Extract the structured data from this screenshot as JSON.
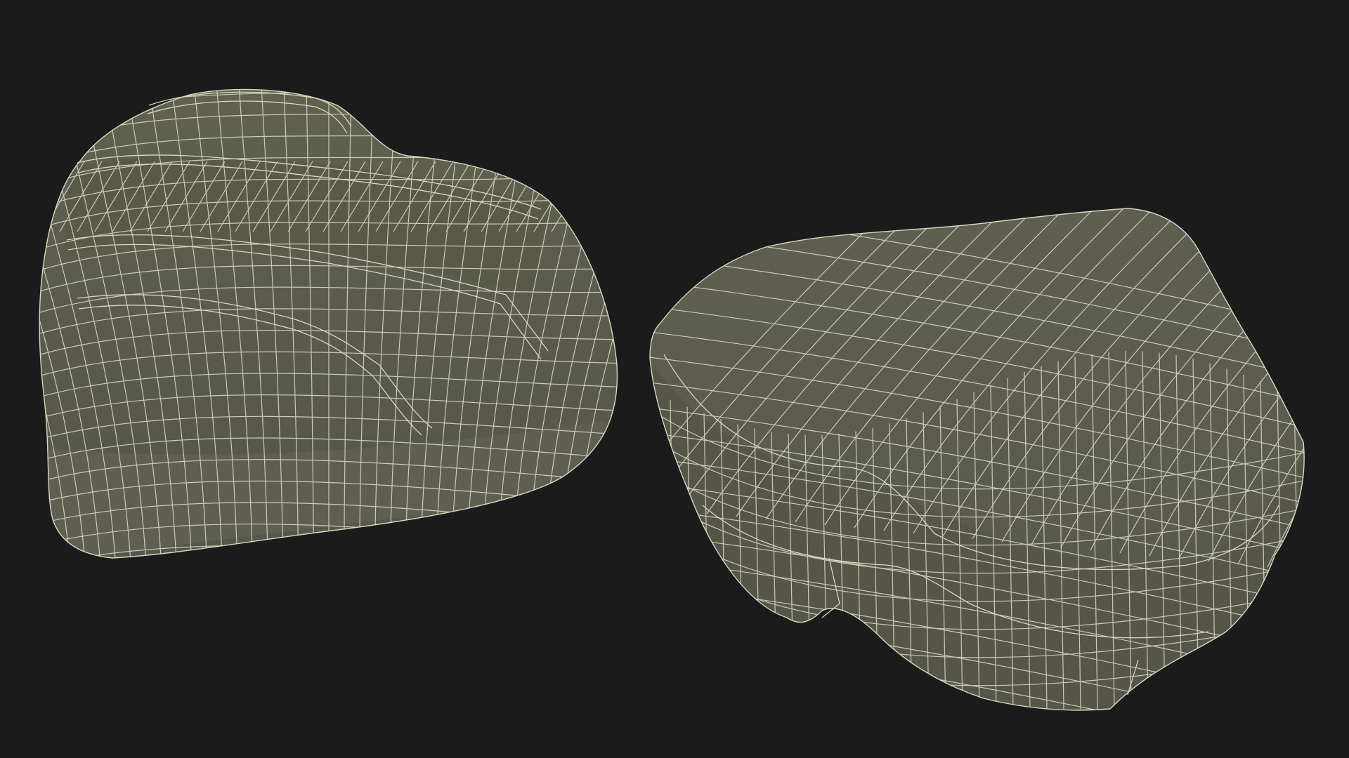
{
  "scene": {
    "background_color": "#1b1b1b",
    "mesh_fill_color": "#5b5c4e",
    "mesh_shade_color": "#4c4d41",
    "wire_color": "#d7d7c4",
    "objects": [
      {
        "name": "wireframe-model-left",
        "view": "front-top"
      },
      {
        "name": "wireframe-model-right",
        "view": "top"
      }
    ]
  }
}
